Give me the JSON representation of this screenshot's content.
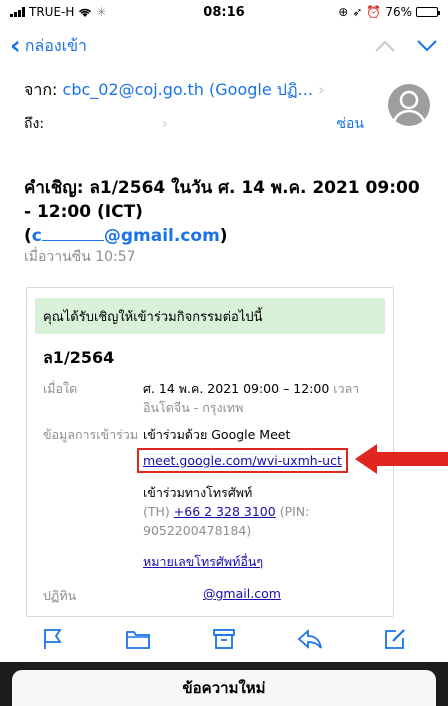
{
  "status": {
    "carrier": "TRUE-H",
    "time": "08:16",
    "battery_text": "76%",
    "battery_level": 0.76
  },
  "nav": {
    "back_label": "กล่องเข้า"
  },
  "header": {
    "from_label": "จาก:",
    "from_value": "cbc_02@coj.go.th (Google ปฏิ...",
    "to_label": "ถึง:",
    "hide_label": "ซ่อน"
  },
  "subject": {
    "title": "คำเชิญ: ล1/2564 ในวัน ศ. 14 พ.ค. 2021 09:00 - 12:00 (ICT)",
    "email_open": "(",
    "email_start": "c",
    "email_end": "@gmail.com",
    "email_close": ")"
  },
  "date": "เมื่อวานซืน 10:57",
  "card": {
    "banner": "คุณได้รับเชิญให้เข้าร่วมกิจกรรมต่อไปนี้",
    "event_title": "ล1/2564",
    "when_label": "เมื่อใด",
    "when_value": "ศ. 14 พ.ค. 2021 09:00 – 12:00",
    "when_tz": "เวลาอินโดจีน - กรุงเทพ",
    "join_label": "ข้อมูลการเข้าร่วม",
    "join_meet": "เข้าร่วมด้วย Google Meet",
    "meet_link": "meet.google.com/wvi-uxmh-uct",
    "join_phone": "เข้าร่วมทางโทรศัพท์",
    "phone_prefix": "(TH)",
    "phone_number": "+66 2 328 3100",
    "phone_pin": "(PIN: 9052200478184)",
    "more_phones": "หมายเลขโทรศัพท์อื่นๆ",
    "calendar_label": "ปฏิทิน",
    "calendar_value": "@gmail.com"
  },
  "sheet": {
    "title": "ข้อความใหม่"
  },
  "colors": {
    "accent": "#1a73e8",
    "highlight": "#e0261f",
    "banner": "#d9f0d9"
  }
}
